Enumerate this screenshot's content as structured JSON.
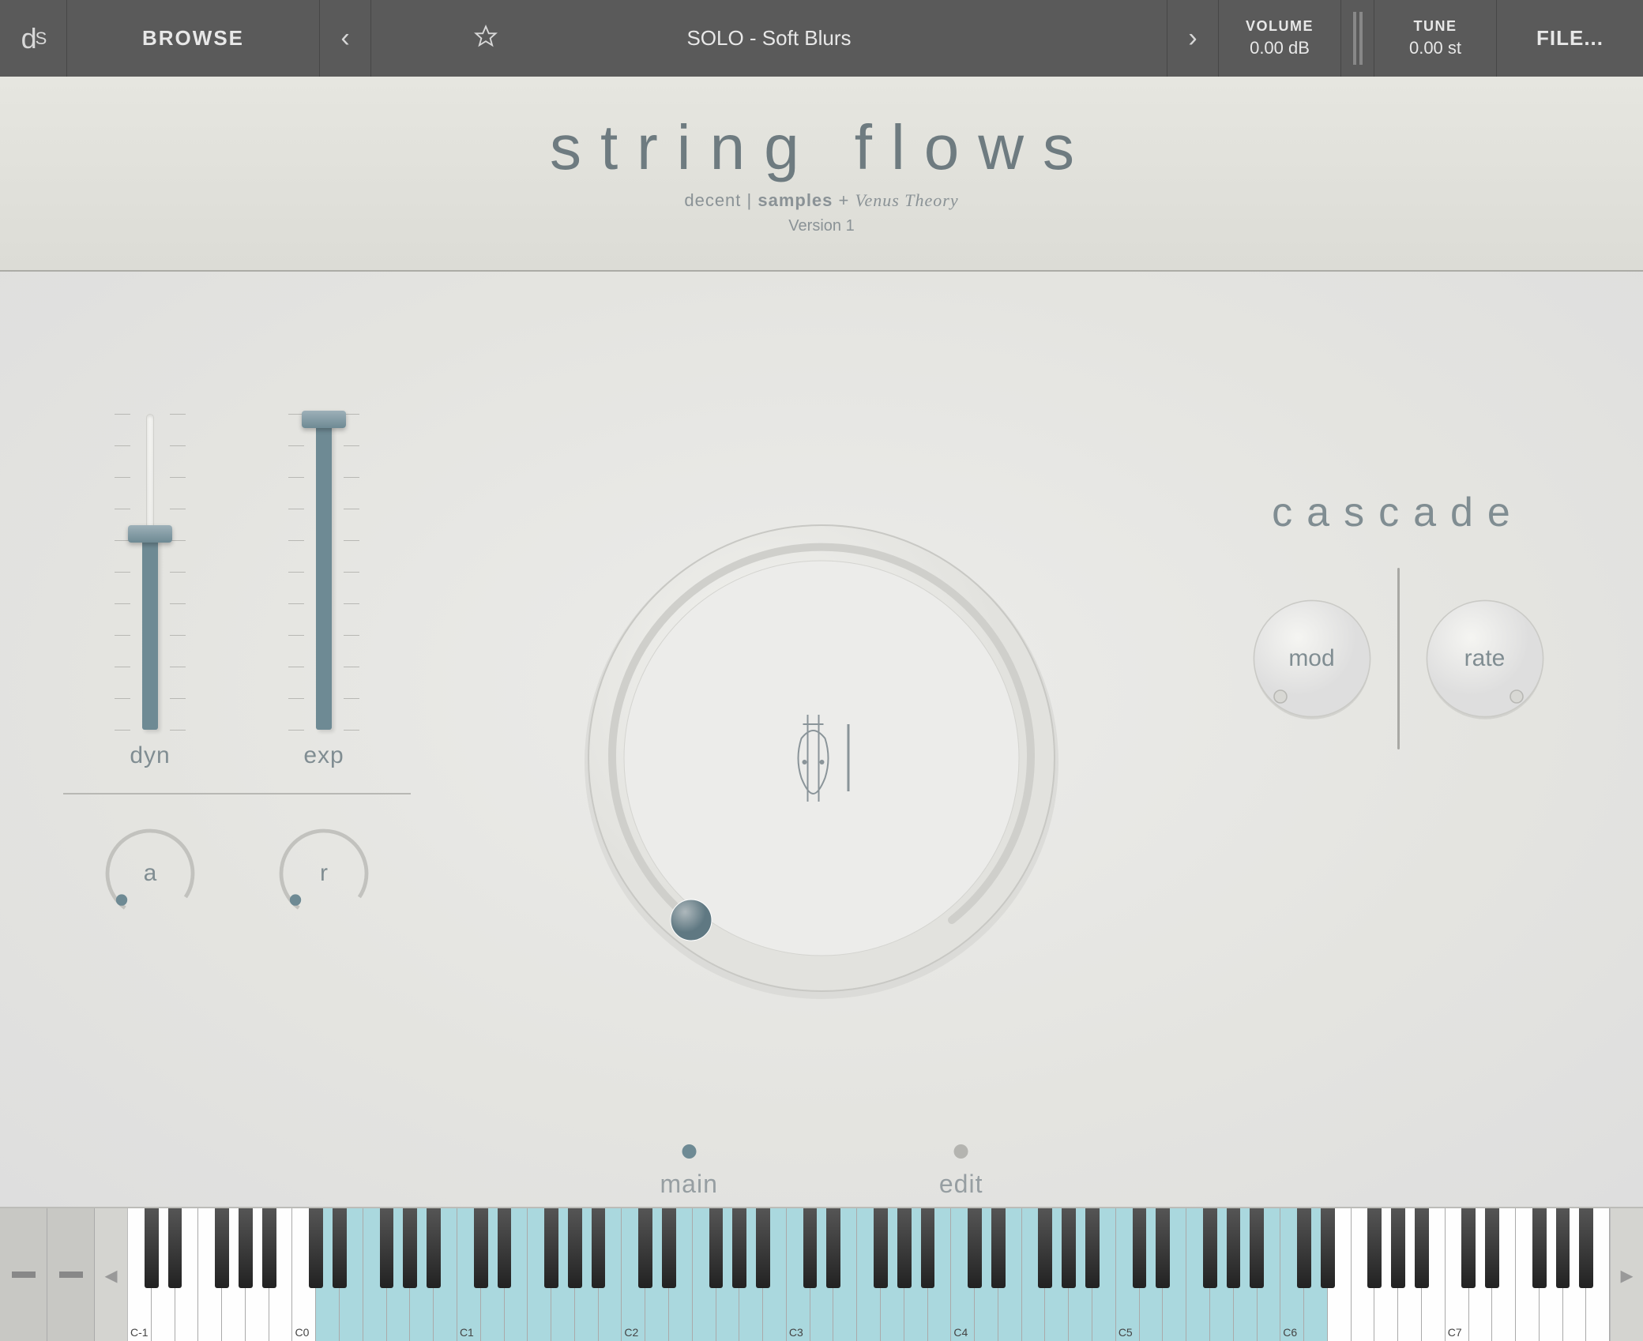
{
  "topbar": {
    "logo_main": "d",
    "logo_sub": "S",
    "browse": "BROWSE",
    "preset_name": "SOLO - Soft Blurs",
    "volume_label": "VOLUME",
    "volume_value": "0.00 dB",
    "tune_label": "TUNE",
    "tune_value": "0.00 st",
    "file": "FILE..."
  },
  "header": {
    "title": "string flows",
    "subtitle_prefix": "decent | ",
    "subtitle_bold": "samples",
    "subtitle_plus": " + ",
    "subtitle_script": "Venus Theory",
    "version": "Version 1"
  },
  "sliders": {
    "dyn": {
      "label": "dyn",
      "position": 0.62
    },
    "exp": {
      "label": "exp",
      "position": 1.0
    }
  },
  "ar": {
    "a_label": "a",
    "r_label": "r"
  },
  "big_knob": {
    "value": 0.0
  },
  "cascade": {
    "title": "cascade",
    "mod_label": "mod",
    "rate_label": "rate"
  },
  "tabs": {
    "main": {
      "label": "main",
      "active": true
    },
    "edit": {
      "label": "edit",
      "active": false
    }
  },
  "keyboard": {
    "white_key_count": 63,
    "mapped_start": 8,
    "mapped_end": 50,
    "octaves": [
      "C-1",
      "C0",
      "C1",
      "C2",
      "C3",
      "C4",
      "C5",
      "C6",
      "C7"
    ]
  }
}
